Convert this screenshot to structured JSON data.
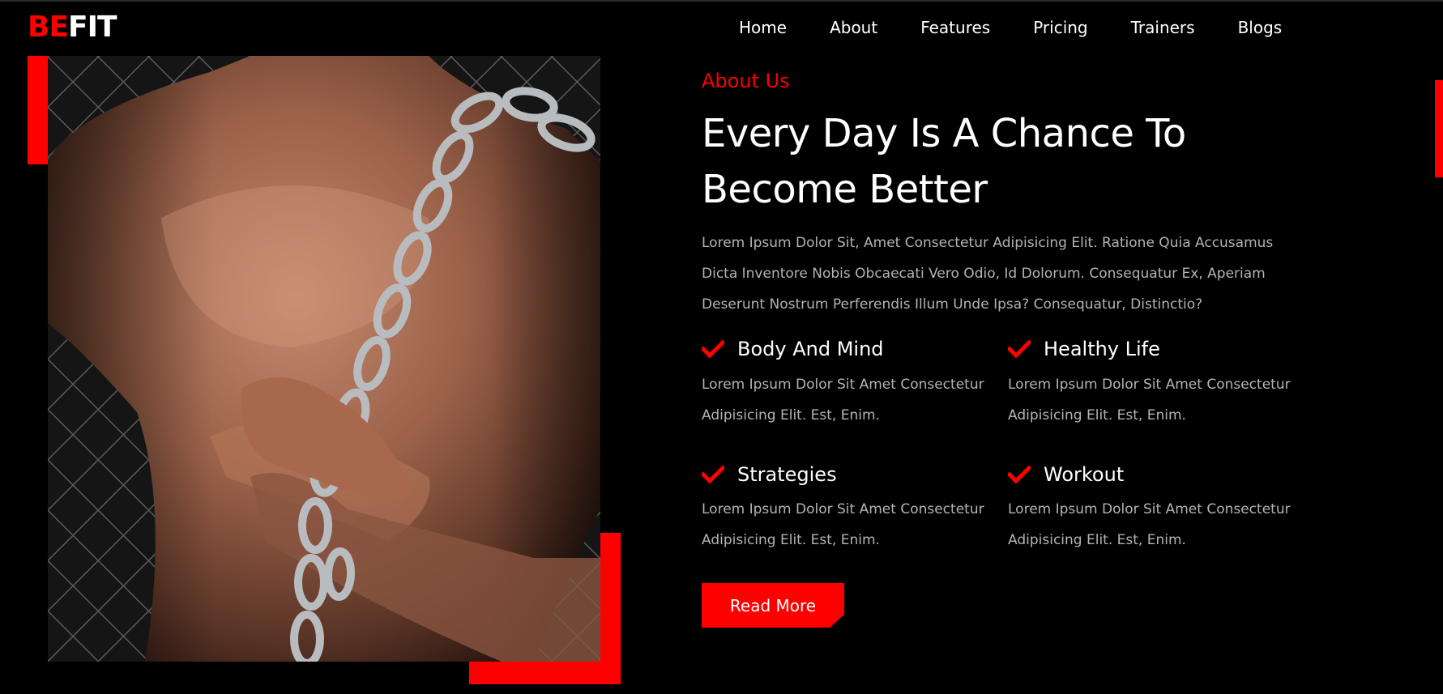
{
  "brand": {
    "part1": "BE",
    "part2": "FIT"
  },
  "nav": {
    "items": [
      "Home",
      "About",
      "Features",
      "Pricing",
      "Trainers",
      "Blogs"
    ]
  },
  "about": {
    "eyebrow": "About Us",
    "title_line1": "Every Day Is A Chance To",
    "title_line2": "Become Better",
    "description": "Lorem Ipsum Dolor Sit, Amet Consectetur Adipisicing Elit. Ratione Quia Accusamus Dicta Inventore Nobis Obcaecati Vero Odio, Id Dolorum. Consequatur Ex, Aperiam Deserunt Nostrum Perferendis Illum Unde Ipsa? Consequatur, Distinctio?",
    "features": [
      {
        "title": "Body And Mind",
        "text": "Lorem Ipsum Dolor Sit Amet Consectetur Adipisicing Elit. Est, Enim."
      },
      {
        "title": "Healthy Life",
        "text": "Lorem Ipsum Dolor Sit Amet Consectetur Adipisicing Elit. Est, Enim."
      },
      {
        "title": "Strategies",
        "text": "Lorem Ipsum Dolor Sit Amet Consectetur Adipisicing Elit. Est, Enim."
      },
      {
        "title": "Workout",
        "text": "Lorem Ipsum Dolor Sit Amet Consectetur Adipisicing Elit. Est, Enim."
      }
    ],
    "button_label": "Read More"
  },
  "colors": {
    "accent": "#ff0000",
    "background": "#000000",
    "muted_text": "#b3b3b3"
  },
  "icons": {
    "feature_icon": "check-icon"
  }
}
